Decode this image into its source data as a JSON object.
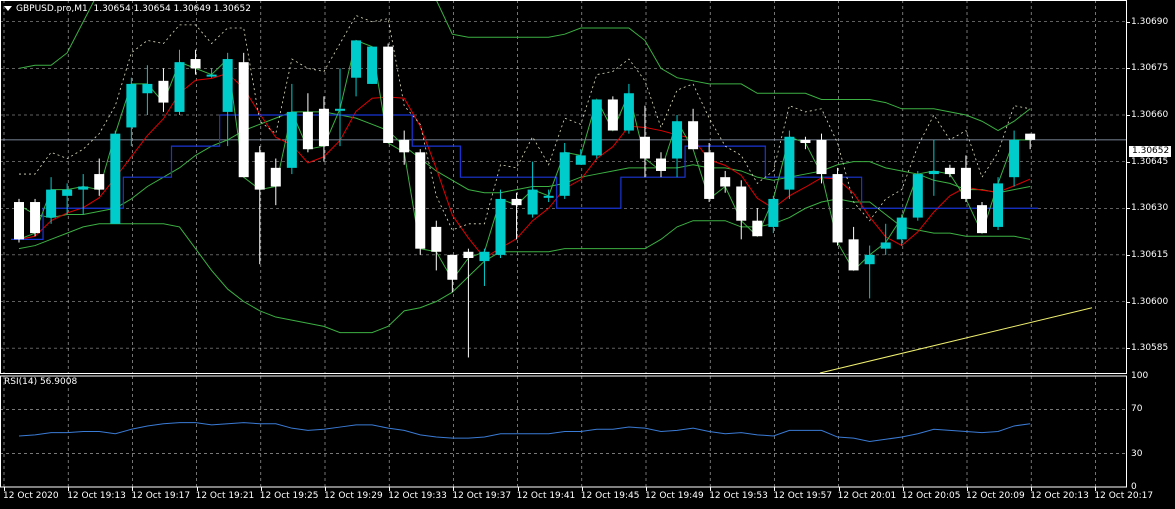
{
  "header": {
    "symbol_label": "GBPUSD.pro,M1",
    "ohlc": "1.30654 1.30654 1.30649 1.30652"
  },
  "price_axis": {
    "labels": [
      "1.30690",
      "1.30675",
      "1.30660",
      "1.30645",
      "1.30630",
      "1.30615",
      "1.30600",
      "1.30585"
    ],
    "values": [
      1.3069,
      1.30675,
      1.3066,
      1.30645,
      1.3063,
      1.30615,
      1.306,
      1.30585
    ],
    "current_price": "1.30652",
    "current_price_value": 1.30652
  },
  "rsi_panel": {
    "label": "RSI(14) 56.9008",
    "axis_labels": [
      "100",
      "70",
      "30",
      "0"
    ],
    "axis_values": [
      100,
      70,
      30,
      0
    ]
  },
  "time_axis": {
    "labels": [
      "12 Oct 2020",
      "12 Oct 19:13",
      "12 Oct 19:17",
      "12 Oct 19:21",
      "12 Oct 19:25",
      "12 Oct 19:29",
      "12 Oct 19:33",
      "12 Oct 19:37",
      "12 Oct 19:41",
      "12 Oct 19:45",
      "12 Oct 19:49",
      "12 Oct 19:53",
      "12 Oct 19:57",
      "12 Oct 20:01",
      "12 Oct 20:05",
      "12 Oct 20:09",
      "12 Oct 20:13",
      "12 Oct 20:17"
    ]
  },
  "colors": {
    "background": "#000000",
    "grid": "#c0c0c0",
    "bull_candle": "#00cccc",
    "bear_candle": "#ffffff",
    "bollinger": "#3cb043",
    "ma_red": "#e00000",
    "ma_blue": "#1a35d6",
    "rsi_line": "#3a7bd5",
    "yellow_line": "#f0f070",
    "dotted": "#e0e0c0"
  },
  "chart_data": {
    "type": "candlestick",
    "symbol": "GBPUSD.pro",
    "timeframe": "M1",
    "candles": [
      [
        1.30632,
        1.30633,
        1.30619,
        1.3062
      ],
      [
        1.30632,
        1.30633,
        1.30621,
        1.30622
      ],
      [
        1.30627,
        1.3064,
        1.30625,
        1.30636
      ],
      [
        1.30634,
        1.30638,
        1.30628,
        1.30636
      ],
      [
        1.30636,
        1.30641,
        1.30628,
        1.30637
      ],
      [
        1.30641,
        1.30646,
        1.30634,
        1.30636
      ],
      [
        1.30625,
        1.30655,
        1.30625,
        1.30654
      ],
      [
        1.30656,
        1.30672,
        1.3065,
        1.3067
      ],
      [
        1.30667,
        1.30676,
        1.3066,
        1.3067
      ],
      [
        1.30671,
        1.30675,
        1.30661,
        1.30664
      ],
      [
        1.30661,
        1.30681,
        1.3066,
        1.30677
      ],
      [
        1.30678,
        1.30681,
        1.30673,
        1.30675
      ],
      [
        1.30673,
        1.30675,
        1.30672,
        1.30673
      ],
      [
        1.30661,
        1.3068,
        1.3065,
        1.30678
      ],
      [
        1.30677,
        1.3068,
        1.3064,
        1.3064
      ],
      [
        1.30648,
        1.3065,
        1.30612,
        1.30636
      ],
      [
        1.30643,
        1.30646,
        1.30631,
        1.30637
      ],
      [
        1.30643,
        1.3067,
        1.30641,
        1.30661
      ],
      [
        1.30661,
        1.30667,
        1.30648,
        1.30649
      ],
      [
        1.30662,
        1.30666,
        1.30645,
        1.3065
      ],
      [
        1.30662,
        1.30675,
        1.3065,
        1.30662
      ],
      [
        1.30672,
        1.30684,
        1.30666,
        1.30684
      ],
      [
        1.3067,
        1.30682,
        1.3067,
        1.30682
      ],
      [
        1.30682,
        1.30683,
        1.30651,
        1.30651
      ],
      [
        1.30652,
        1.30655,
        1.30644,
        1.30648
      ],
      [
        1.30648,
        1.30649,
        1.30615,
        1.30617
      ],
      [
        1.30624,
        1.30626,
        1.3061,
        1.30616
      ],
      [
        1.30615,
        1.30615,
        1.30603,
        1.30607
      ],
      [
        1.30616,
        1.30617,
        1.30582,
        1.30614
      ],
      [
        1.30613,
        1.30617,
        1.30605,
        1.30616
      ],
      [
        1.30615,
        1.30636,
        1.30614,
        1.30633
      ],
      [
        1.30633,
        1.30635,
        1.3062,
        1.30631
      ],
      [
        1.30628,
        1.30645,
        1.30627,
        1.30636
      ],
      [
        1.30634,
        1.30636,
        1.30632,
        1.30634
      ],
      [
        1.30634,
        1.30651,
        1.30633,
        1.30648
      ],
      [
        1.30644,
        1.30649,
        1.30644,
        1.30647
      ],
      [
        1.30647,
        1.30665,
        1.30646,
        1.30665
      ],
      [
        1.30665,
        1.30666,
        1.30655,
        1.30655
      ],
      [
        1.30655,
        1.3067,
        1.30654,
        1.30667
      ],
      [
        1.30653,
        1.30663,
        1.3064,
        1.30646
      ],
      [
        1.30646,
        1.30648,
        1.3064,
        1.30642
      ],
      [
        1.30646,
        1.3066,
        1.3064,
        1.30658
      ],
      [
        1.30658,
        1.30662,
        1.3065,
        1.30649
      ],
      [
        1.30648,
        1.30651,
        1.30632,
        1.30633
      ],
      [
        1.3064,
        1.30642,
        1.30635,
        1.30637
      ],
      [
        1.30637,
        1.30639,
        1.3062,
        1.30626
      ],
      [
        1.30626,
        1.3063,
        1.30621,
        1.30621
      ],
      [
        1.30624,
        1.30634,
        1.30622,
        1.30633
      ],
      [
        1.30636,
        1.30655,
        1.30633,
        1.30653
      ],
      [
        1.30652,
        1.30653,
        1.30649,
        1.30651
      ],
      [
        1.30652,
        1.30654,
        1.30638,
        1.30641
      ],
      [
        1.30641,
        1.30643,
        1.30618,
        1.30619
      ],
      [
        1.3062,
        1.30624,
        1.30612,
        1.3061
      ],
      [
        1.30612,
        1.30618,
        1.30601,
        1.30615
      ],
      [
        1.30617,
        1.30625,
        1.30615,
        1.30619
      ],
      [
        1.3062,
        1.30628,
        1.30618,
        1.30627
      ],
      [
        1.30627,
        1.30642,
        1.30626,
        1.30641
      ],
      [
        1.30641,
        1.30652,
        1.30634,
        1.30642
      ],
      [
        1.30643,
        1.30644,
        1.3064,
        1.30641
      ],
      [
        1.30643,
        1.30647,
        1.30632,
        1.30633
      ],
      [
        1.30631,
        1.30632,
        1.30622,
        1.30622
      ],
      [
        1.30624,
        1.3064,
        1.30623,
        1.30638
      ],
      [
        1.3064,
        1.30655,
        1.30637,
        1.30652
      ],
      [
        1.30654,
        1.30654,
        1.30649,
        1.30652
      ]
    ],
    "bollinger_upper": [
      1.30675,
      1.30676,
      1.30676,
      1.3068,
      1.3069,
      1.307,
      1.30707,
      1.30712,
      1.3072,
      1.30725,
      1.3073,
      1.30734,
      1.30732,
      1.30728,
      1.3072,
      1.30712,
      1.30712,
      1.30707,
      1.30706,
      1.3071,
      1.30707,
      1.30705,
      1.307,
      1.307,
      1.307,
      1.30698,
      1.30697,
      1.30686,
      1.30685,
      1.30685,
      1.30685,
      1.30685,
      1.30685,
      1.30685,
      1.30686,
      1.30688,
      1.30688,
      1.30688,
      1.30688,
      1.30684,
      1.30675,
      1.30672,
      1.30671,
      1.3067,
      1.3067,
      1.3067,
      1.30667,
      1.30667,
      1.30667,
      1.30667,
      1.30665,
      1.30665,
      1.30665,
      1.30665,
      1.30664,
      1.30662,
      1.30662,
      1.30662,
      1.30661,
      1.3066,
      1.30658,
      1.30655,
      1.30658,
      1.30662
    ],
    "bollinger_middle": [
      1.30631,
      1.30628,
      1.30627,
      1.30628,
      1.30628,
      1.30629,
      1.3063,
      1.30633,
      1.30637,
      1.3064,
      1.30643,
      1.30647,
      1.3065,
      1.30652,
      1.30655,
      1.30657,
      1.30659,
      1.30661,
      1.30661,
      1.30661,
      1.3066,
      1.30659,
      1.30657,
      1.30655,
      1.3065,
      1.30646,
      1.30642,
      1.30639,
      1.30636,
      1.30635,
      1.30635,
      1.30636,
      1.30637,
      1.30637,
      1.30638,
      1.3064,
      1.30641,
      1.30642,
      1.30643,
      1.30643,
      1.30643,
      1.30643,
      1.30644,
      1.30643,
      1.30643,
      1.30642,
      1.3064,
      1.30639,
      1.3064,
      1.30641,
      1.30642,
      1.30644,
      1.30645,
      1.30645,
      1.30643,
      1.30642,
      1.30641,
      1.30639,
      1.30638,
      1.30636,
      1.30636,
      1.30635,
      1.30636,
      1.30637
    ],
    "bollinger_lower": [
      1.30617,
      1.30618,
      1.3062,
      1.30622,
      1.30624,
      1.30625,
      1.30625,
      1.30625,
      1.30625,
      1.30625,
      1.30624,
      1.30617,
      1.3061,
      1.30604,
      1.306,
      1.30597,
      1.30595,
      1.30594,
      1.30593,
      1.30592,
      1.3059,
      1.3059,
      1.3059,
      1.30592,
      1.30597,
      1.30598,
      1.306,
      1.30603,
      1.30608,
      1.30613,
      1.30616,
      1.30616,
      1.30616,
      1.30616,
      1.30617,
      1.30617,
      1.30617,
      1.30617,
      1.30617,
      1.30617,
      1.3062,
      1.30624,
      1.30626,
      1.30626,
      1.30626,
      1.30624,
      1.30624,
      1.30625,
      1.30627,
      1.3063,
      1.30632,
      1.30633,
      1.30632,
      1.30632,
      1.30628,
      1.30624,
      1.30623,
      1.30622,
      1.30622,
      1.30621,
      1.30621,
      1.30621,
      1.30621,
      1.3062
    ],
    "rsi": [
      46,
      47,
      49,
      49,
      50,
      50,
      48,
      52,
      55,
      57,
      58,
      58,
      56,
      57,
      58,
      57,
      57,
      53,
      51,
      52,
      54,
      56,
      56,
      53,
      51,
      47,
      45,
      44,
      44,
      45,
      48,
      48,
      48,
      48,
      50,
      50,
      52,
      52,
      54,
      53,
      50,
      51,
      53,
      50,
      48,
      49,
      47,
      46,
      51,
      51,
      51,
      45,
      44,
      41,
      43,
      45,
      48,
      52,
      51,
      50,
      49,
      50,
      55,
      57
    ],
    "rsi_current": 56.9008
  }
}
